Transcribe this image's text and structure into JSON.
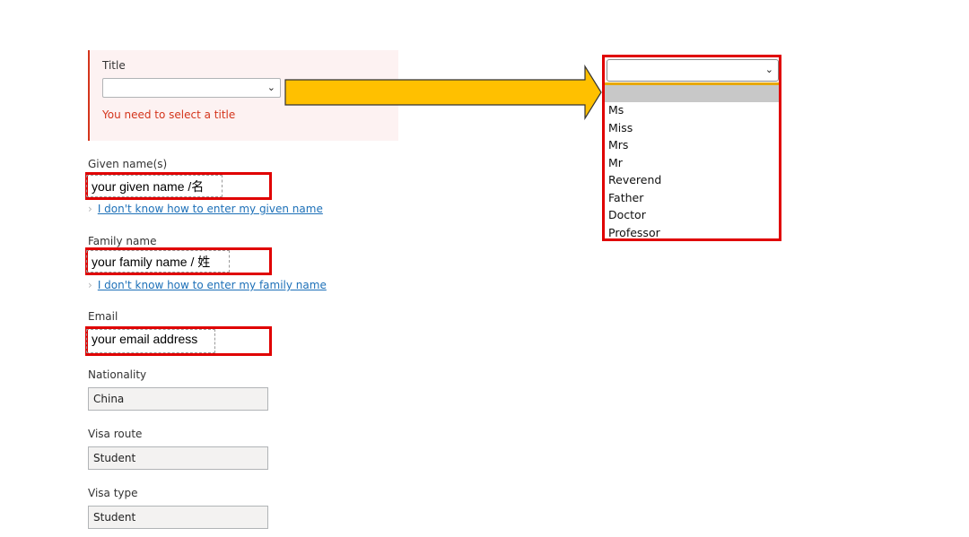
{
  "form": {
    "title": {
      "label": "Title",
      "value": "",
      "error": "You need to select a title"
    },
    "given_name": {
      "label": "Given name(s)",
      "value": "your given name /名",
      "help_link": "I don't know how to enter my given name"
    },
    "family_name": {
      "label": "Family name",
      "value": "your family name / 姓",
      "help_link": "I don't know how to enter my family name"
    },
    "email": {
      "label": "Email",
      "value": "your email address"
    },
    "nationality": {
      "label": "Nationality",
      "value": "China"
    },
    "visa_route": {
      "label": "Visa route",
      "value": "Student"
    },
    "visa_type": {
      "label": "Visa type",
      "value": "Student"
    }
  },
  "title_dropdown": {
    "value": "",
    "options": [
      "Ms",
      "Miss",
      "Mrs",
      "Mr",
      "Reverend",
      "Father",
      "Doctor",
      "Professor"
    ]
  },
  "colors": {
    "error": "#d4351c",
    "highlight_border": "#e00000",
    "arrow_fill": "#ffc000",
    "link": "#1d70b8"
  }
}
